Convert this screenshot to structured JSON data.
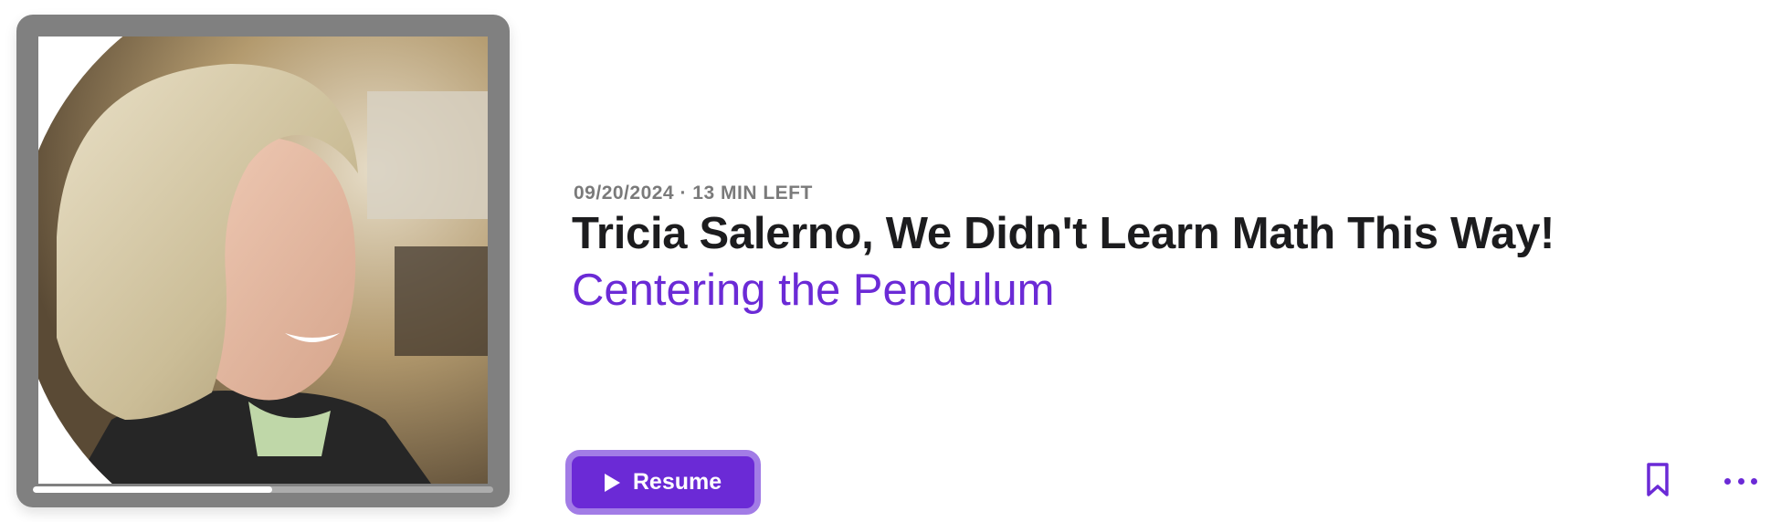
{
  "episode": {
    "date": "09/20/2024",
    "separator": "·",
    "time_left": "13 MIN LEFT",
    "title": "Tricia Salerno, We Didn't Learn Math This Way!",
    "show": "Centering the Pendulum",
    "progress_fraction": 0.52
  },
  "actions": {
    "resume_label": "Resume",
    "play_icon": "play-icon",
    "bookmark_icon": "bookmark-icon",
    "more_icon": "more-options-icon"
  },
  "colors": {
    "accent": "#6b2ad6",
    "accent_border": "#a27ce6",
    "frame": "#808080",
    "meta_text": "#7a7a7a",
    "title_text": "#1c1c1e"
  }
}
